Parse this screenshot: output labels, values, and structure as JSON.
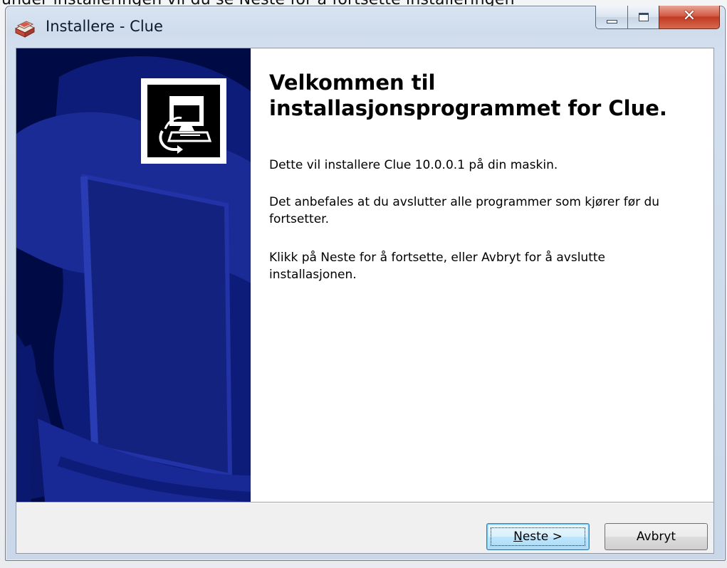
{
  "background": {
    "text": "under installeringen vil du se Neste for å fortsette installeringen"
  },
  "window": {
    "title": "Installere - Clue",
    "icon": "installer-box-icon",
    "caption_buttons": [
      "minimize",
      "maximize",
      "close"
    ]
  },
  "wizard_image": {
    "icon": "computer-install-icon",
    "colors": {
      "background": "#000a45",
      "accent": "#1e2f9a"
    }
  },
  "welcome": {
    "title": "Velkommen til installasjonsprogrammet for Clue.",
    "paragraphs": [
      "Dette vil installere Clue 10.0.0.1 på din maskin.",
      "Det anbefales at du avslutter alle programmer som kjører før du fortsetter.",
      "Klikk på Neste for å fortsette, eller Avbryt for å avslutte installasjonen."
    ]
  },
  "buttons": {
    "next": {
      "mnemonic": "N",
      "rest": "este >"
    },
    "cancel": "Avbryt"
  }
}
